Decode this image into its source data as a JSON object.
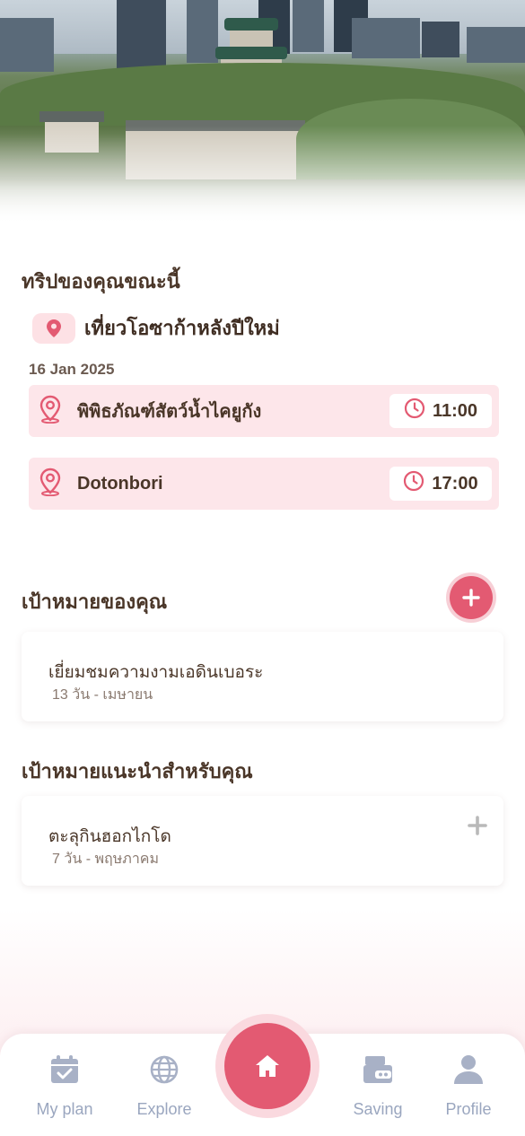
{
  "current_trip": {
    "heading": "ทริปของคุณขณะนี้",
    "name": "เที่ยวโอซาก้าหลังปีใหม่",
    "date": "16 Jan 2025",
    "stops": [
      {
        "name": "พิพิธภัณฑ์สัตว์น้ำไคยูกัง",
        "time": "11:00"
      },
      {
        "name": "Dotonbori",
        "time": "17:00"
      }
    ]
  },
  "goals": {
    "heading": "เป้าหมายของคุณ",
    "items": [
      {
        "title": "เยี่ยมชมความงามเอดินเบอระ",
        "subtitle": "13 วัน - เมษายน"
      }
    ]
  },
  "recommended": {
    "heading": "เป้าหมายแนะนำสำหรับคุณ",
    "items": [
      {
        "title": "ตะลุกินฮอกไกโด",
        "subtitle": "7 วัน - พฤษภาคม"
      }
    ]
  },
  "nav": {
    "my_plan": "My plan",
    "explore": "Explore",
    "saving": "Saving",
    "profile": "Profile"
  },
  "icons": {
    "pin": "map-pin-icon",
    "clock": "clock-icon",
    "plus": "plus-icon",
    "home": "home-icon"
  },
  "colors": {
    "accent": "#e35a72",
    "chip_bg": "#fde6ea",
    "nav_inactive": "#9aa6bf",
    "text_dark": "#4a3628"
  }
}
